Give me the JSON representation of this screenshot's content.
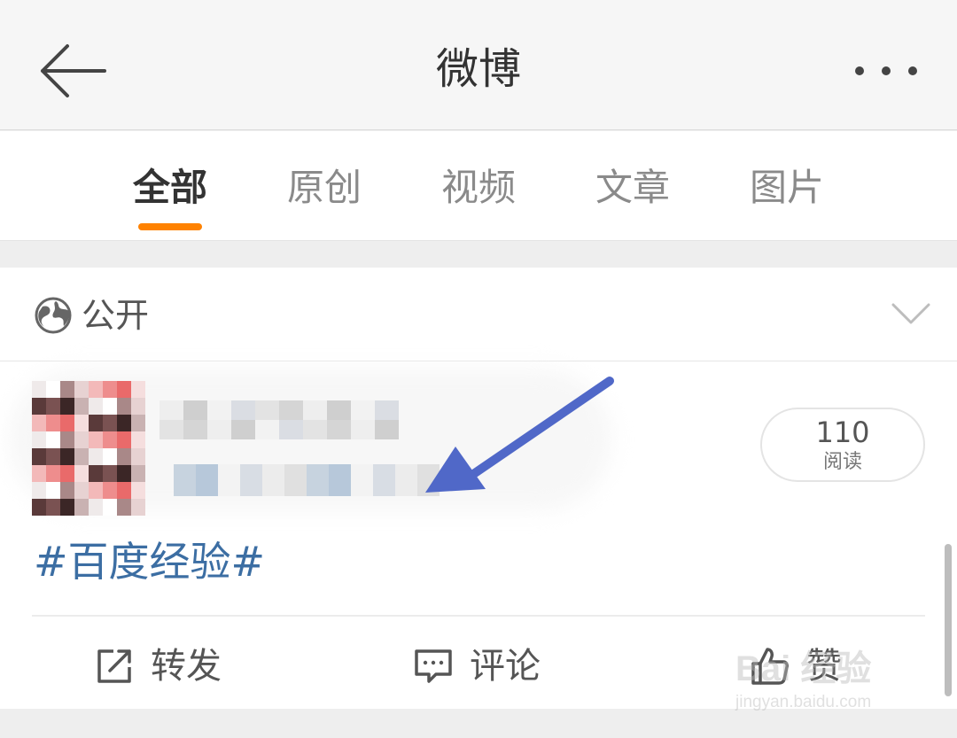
{
  "header": {
    "title": "微博",
    "back_icon": "arrow-left-icon",
    "more_icon": "more-dots-icon"
  },
  "tabs": [
    {
      "label": "全部",
      "active": true
    },
    {
      "label": "原创",
      "active": false
    },
    {
      "label": "视频",
      "active": false
    },
    {
      "label": "文章",
      "active": false
    },
    {
      "label": "图片",
      "active": false
    }
  ],
  "colors": {
    "accent": "#ff8200",
    "topic_link": "#3c6ea3",
    "annotation_arrow": "#5068c8"
  },
  "post": {
    "visibility": "公开",
    "read_count": "110",
    "read_label": "阅读",
    "topic": "#百度经验#",
    "actions": {
      "repost": "转发",
      "comment": "评论",
      "like": "赞"
    }
  },
  "watermark": {
    "brand": "Bai 经验",
    "site": "jingyan.baidu.com"
  }
}
